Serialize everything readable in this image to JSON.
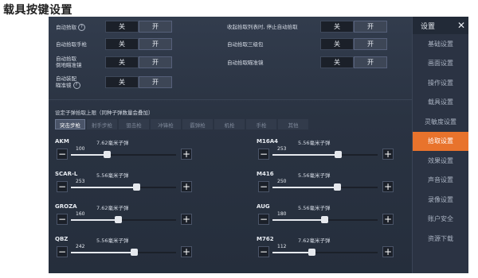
{
  "caption": "载具按键设置",
  "sidebar": {
    "title": "设置",
    "close": "✕",
    "items": [
      {
        "label": "基础设置",
        "active": false
      },
      {
        "label": "画面设置",
        "active": false
      },
      {
        "label": "操作设置",
        "active": false
      },
      {
        "label": "载具设置",
        "active": false
      },
      {
        "label": "灵敏度设置",
        "active": false
      },
      {
        "label": "拾取设置",
        "active": true
      },
      {
        "label": "效果设置",
        "active": false
      },
      {
        "label": "声音设置",
        "active": false
      },
      {
        "label": "录像设置",
        "active": false
      },
      {
        "label": "账户安全",
        "active": false
      },
      {
        "label": "资源下载",
        "active": false
      }
    ]
  },
  "toggles": {
    "off_label": "关",
    "on_label": "开",
    "left": [
      {
        "label": "自动拾取",
        "help": "?",
        "selected": "off"
      },
      {
        "label": "自动拾取手枪",
        "help": "",
        "selected": "off"
      },
      {
        "label": "自动拾取\n倒地瞄准镜",
        "help": "",
        "selected": "off"
      },
      {
        "label": "自动装配\n瞄准镜",
        "help": "?",
        "selected": "off"
      }
    ],
    "right": [
      {
        "label": "收起拾取列表时, 停止自动拾取",
        "selected": "off"
      },
      {
        "label": "自动拾取三级包",
        "selected": "off"
      },
      {
        "label": "自动拾取瞄准镜",
        "selected": "off"
      }
    ]
  },
  "limit": {
    "title": "设定子弹拾取上限（同种子弹数量会叠加）",
    "tabs": [
      "突击步枪",
      "射手步枪",
      "狙击枪",
      "冲锋枪",
      "霰弹枪",
      "机枪",
      "手枪",
      "其他"
    ],
    "active_tab": 0
  },
  "weapons": [
    {
      "name": "AKM",
      "ammo": "7.62毫米子弹",
      "value": "100",
      "level": 0.34
    },
    {
      "name": "M16A4",
      "ammo": "5.56毫米子弹",
      "value": "253",
      "level": 0.62
    },
    {
      "name": "SCAR-L",
      "ammo": "5.56毫米子弹",
      "value": "253",
      "level": 0.62
    },
    {
      "name": "M416",
      "ammo": "5.56毫米子弹",
      "value": "250",
      "level": 0.61
    },
    {
      "name": "GROZA",
      "ammo": "7.62毫米子弹",
      "value": "160",
      "level": 0.45
    },
    {
      "name": "AUG",
      "ammo": "5.56毫米子弹",
      "value": "180",
      "level": 0.49
    },
    {
      "name": "QBZ",
      "ammo": "5.56毫米子弹",
      "value": "242",
      "level": 0.6
    },
    {
      "name": "M762",
      "ammo": "7.62毫米子弹",
      "value": "112",
      "level": 0.37
    }
  ],
  "colors": {
    "accent": "#e8732c",
    "panel": "#2a3342"
  }
}
